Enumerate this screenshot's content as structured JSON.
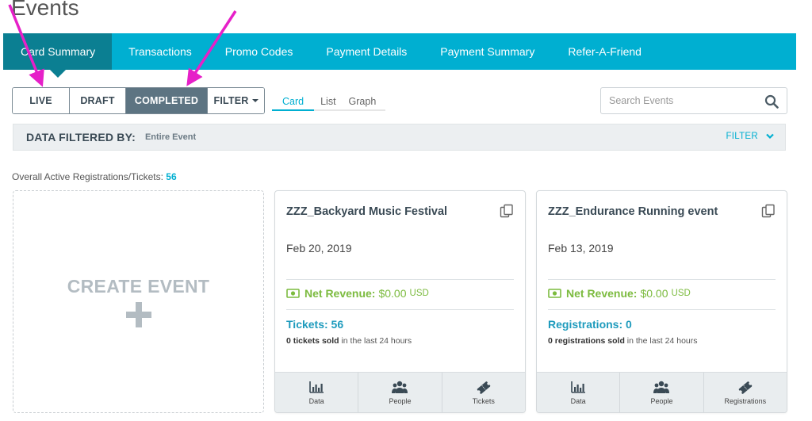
{
  "page": {
    "title": "Events"
  },
  "nav": {
    "items": [
      {
        "label": "Card Summary",
        "active": true
      },
      {
        "label": "Transactions"
      },
      {
        "label": "Promo Codes"
      },
      {
        "label": "Payment Details"
      },
      {
        "label": "Payment Summary"
      },
      {
        "label": "Refer-A-Friend"
      }
    ]
  },
  "status_filters": {
    "live": "LIVE",
    "draft": "DRAFT",
    "completed": "COMPLETED",
    "filter": "FILTER",
    "active": "COMPLETED"
  },
  "view_switch": {
    "card": "Card",
    "list": "List",
    "graph": "Graph",
    "active": "Card"
  },
  "search": {
    "placeholder": "Search Events"
  },
  "filter_bar": {
    "label": "DATA FILTERED BY:",
    "value": "Entire Event",
    "toggle": "FILTER"
  },
  "overall": {
    "label": "Overall Active Registrations/Tickets:",
    "value": "56"
  },
  "create": {
    "label": "CREATE EVENT"
  },
  "events": [
    {
      "title": "ZZZ_Backyard Music Festival",
      "date": "Feb 20, 2019",
      "revenue_label": "Net Revenue:",
      "revenue_value": "$0.00",
      "revenue_currency": "USD",
      "stat": "Tickets: 56",
      "sold_bold": "0 tickets sold",
      "sold_rest": "in the last 24 hours",
      "footer": [
        "Data",
        "People",
        "Tickets"
      ]
    },
    {
      "title": "ZZZ_Endurance Running event",
      "date": "Feb 13, 2019",
      "revenue_label": "Net Revenue:",
      "revenue_value": "$0.00",
      "revenue_currency": "USD",
      "stat": "Registrations: 0",
      "sold_bold": "0 registrations sold",
      "sold_rest": "in the last 24 hours",
      "footer": [
        "Data",
        "People",
        "Registrations"
      ]
    }
  ],
  "colors": {
    "nav_bg": "#00afd1",
    "nav_active": "#0b7f92",
    "status_active": "#5d7482",
    "revenue": "#7cbb3f",
    "stat": "#1e9bbd",
    "annotation_arrow": "#e620c8"
  },
  "icons": [
    "search-icon",
    "chevron-down-icon",
    "plus-icon",
    "copy-icon",
    "money-icon",
    "bar-chart-icon",
    "people-icon",
    "ticket-icon"
  ]
}
